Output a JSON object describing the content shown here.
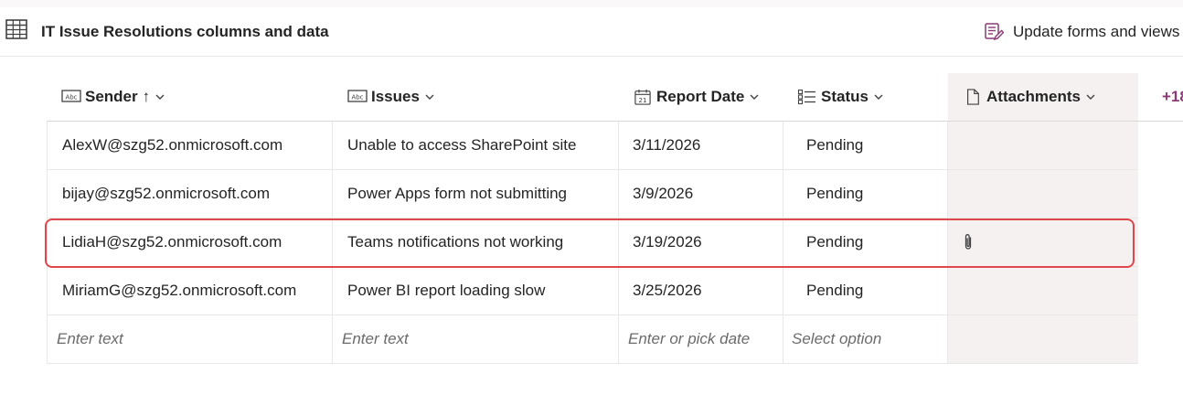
{
  "header": {
    "title": "IT Issue Resolutions columns and data",
    "update_label": "Update forms and views"
  },
  "columns": [
    {
      "label": "Sender",
      "type_icon": "text-field-icon",
      "sort": "↑"
    },
    {
      "label": "Issues",
      "type_icon": "text-field-icon"
    },
    {
      "label": "Report Date",
      "type_icon": "calendar-icon"
    },
    {
      "label": "Status",
      "type_icon": "choice-list-icon"
    },
    {
      "label": "Attachments",
      "type_icon": "document-icon"
    }
  ],
  "more_columns": "+18",
  "rows": [
    {
      "sender": "AlexW@szg52.onmicrosoft.com",
      "issue": "Unable to access SharePoint site",
      "date": "3/11/2026",
      "status": "Pending",
      "attachment": false
    },
    {
      "sender": "bijay@szg52.onmicrosoft.com",
      "issue": "Power Apps form not submitting",
      "date": "3/9/2026",
      "status": "Pending",
      "attachment": false
    },
    {
      "sender": "LidiaH@szg52.onmicrosoft.com",
      "issue": "Teams notifications not working",
      "date": "3/19/2026",
      "status": "Pending",
      "attachment": true
    },
    {
      "sender": "MiriamG@szg52.onmicrosoft.com",
      "issue": "Power BI report loading slow",
      "date": "3/25/2026",
      "status": "Pending",
      "attachment": false
    }
  ],
  "new_row": {
    "sender_placeholder": "Enter text",
    "issues_placeholder": "Enter text",
    "date_placeholder": "Enter or pick date",
    "status_placeholder": "Select option"
  },
  "colors": {
    "accent": "#8a3a75",
    "highlight_border": "#e0474c",
    "attachment_column_bg": "#f4f1f0"
  }
}
